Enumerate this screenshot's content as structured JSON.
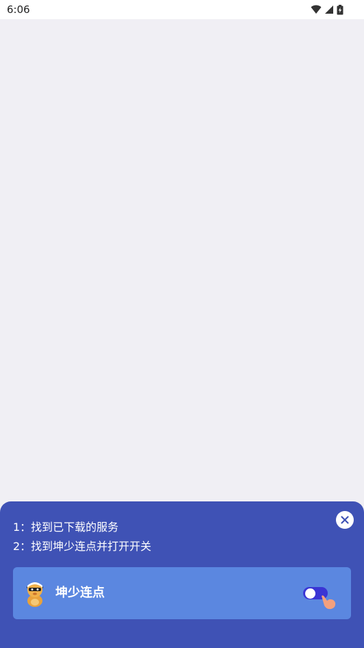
{
  "status_bar": {
    "time": "6:06",
    "icons": [
      "wifi-icon",
      "cellular-signal-icon",
      "battery-charging-icon"
    ]
  },
  "guide_sheet": {
    "steps": [
      "1：找到已下载的服务",
      "2：找到坤少连点并打开开关"
    ],
    "close_icon": "close-icon",
    "service": {
      "name": "坤少连点",
      "avatar": "app-avatar-icon",
      "toggle_state": "on"
    },
    "colors": {
      "sheet_background": "#3f52b5",
      "card_background": "#5b87e0",
      "toggle_on": "#3a35d4"
    }
  }
}
